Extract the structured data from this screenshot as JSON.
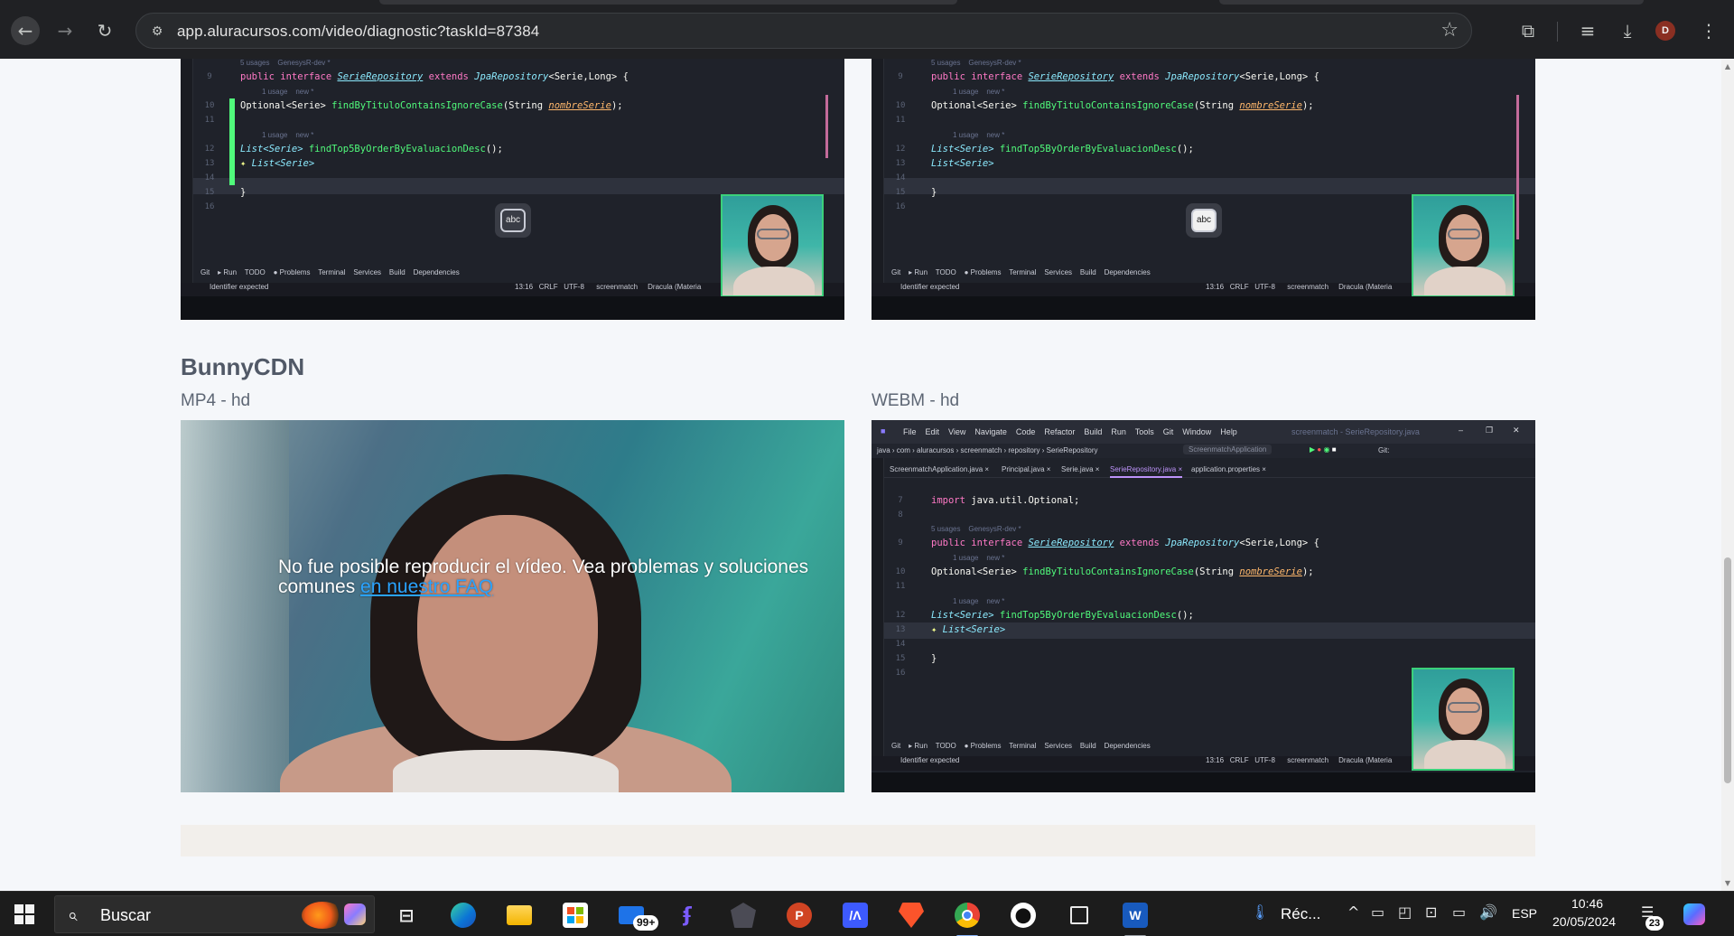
{
  "browser": {
    "url": "app.aluracursos.com/video/diagnostic?taskId=87384",
    "profile_initial": "D",
    "icons": [
      "arrow-left-icon",
      "arrow-right-icon",
      "reload-icon",
      "site-info-icon",
      "star-icon",
      "extensions-icon",
      "media-controls-icon",
      "download-icon",
      "more-vert-icon"
    ]
  },
  "ide": {
    "meta_usages5": "5 usages    GenesysR-dev *",
    "meta_usage1": "1 usage    new *",
    "code_interface": [
      "public interface ",
      "SerieRepository",
      " extends ",
      "JpaRepository",
      "<Serie,Long> {"
    ],
    "code_optional": [
      "Optional<Serie> ",
      "findByTituloContainsIgnoreCase",
      "(String ",
      "nombreSerie",
      ");"
    ],
    "code_list": [
      "List<Serie> ",
      "findTop5ByOrderByEvaluacionDesc",
      "();"
    ],
    "code_cursor": "List<Serie>",
    "code_close": "}",
    "code_import": [
      "import ",
      "java.util.Optional;"
    ],
    "line_numbers_top": [
      "9",
      "10",
      "11",
      "12",
      "13",
      "14",
      "15",
      "16"
    ],
    "line_numbers_webm": [
      "7",
      "8",
      "9",
      "10",
      "11",
      "12",
      "13",
      "14",
      "15",
      "16"
    ],
    "toolbar": "Git    ▸ Run    TODO    ● Problems    Terminal    Services    Build    Dependencies",
    "status_left": "Identifier expected",
    "status_right": "13:16   CRLF   UTF-8      screenmatch     Dracula (Materia",
    "abc_label": "abc",
    "menubar": "File    Edit    View    Navigate    Code    Refactor    Build    Run    Tools    Git    Window    Help",
    "window_title": "screenmatch - SerieRepository.java",
    "breadcrumb": "java › com › aluracursos › screenmatch › repository › SerieRepository",
    "run_config": "ScreenmatchApplication",
    "git_label": "Git:",
    "tabs": [
      "ScreenmatchApplication.java ×",
      "Principal.java ×",
      "Serie.java ×",
      "SerieRepository.java ×",
      "application.properties ×"
    ]
  },
  "section": {
    "title": "BunnyCDN",
    "mp4_label": "MP4 - hd",
    "webm_label": "WEBM - hd"
  },
  "player": {
    "error_text": "No fue posible reproducir el vídeo. Vea problemas y soluciones comunes ",
    "error_link": "en nuestro FAQ"
  },
  "taskbar": {
    "search_placeholder": "Buscar",
    "mail_badge": "99+",
    "weather_text": "Réc...",
    "language": "ESP",
    "time": "10:46",
    "date": "20/05/2024",
    "notification_count": "23",
    "pinned": [
      "task-view-icon",
      "edge-icon",
      "file-explorer-icon",
      "microsoft-store-icon",
      "mail-icon",
      "figma-icon",
      "obsidian-icon",
      "powerpoint-icon",
      "mural-icon",
      "brave-icon",
      "chrome-icon",
      "github-icon",
      "terminal-icon",
      "word-icon"
    ],
    "colors": {
      "chrome_active": "#8ab4f8",
      "taskbar_bg": "#1c1c1c"
    }
  }
}
